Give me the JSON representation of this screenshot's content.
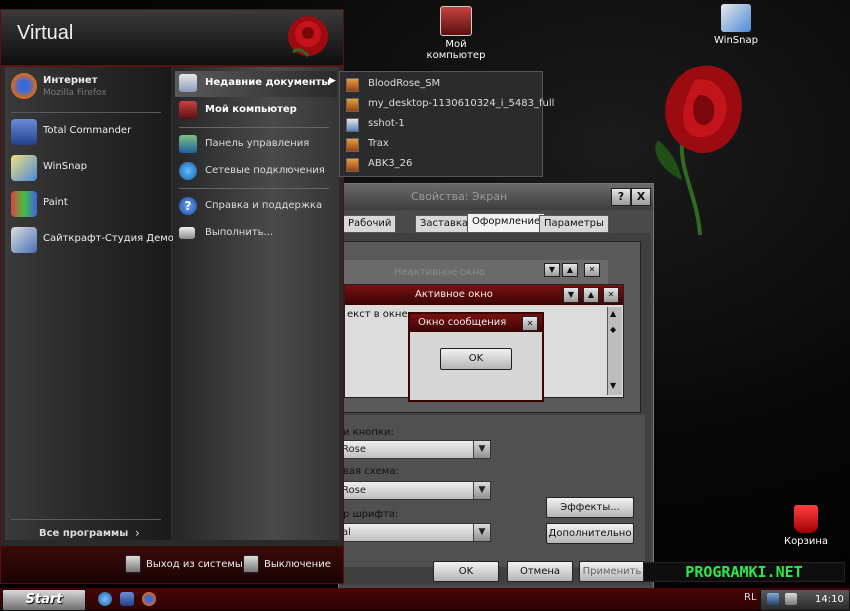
{
  "desktop": {
    "icons": [
      {
        "label_line1": "Мой",
        "label_line2": "компьютер"
      },
      {
        "label": "WinSnap"
      },
      {
        "label": "Корзина"
      }
    ]
  },
  "start_menu": {
    "user": "Virtual",
    "left_items": [
      {
        "label": "Интернет",
        "sublabel": "Mozilla Firefox"
      },
      {
        "label": "Total Commander"
      },
      {
        "label": "WinSnap"
      },
      {
        "label": "Paint"
      },
      {
        "label": "Сайткрафт-Студия Демо"
      }
    ],
    "all_programs": "Все программы",
    "right_items": [
      {
        "label": "Недавние документы"
      },
      {
        "label": "Мой компьютер"
      },
      {
        "label": "Панель управления"
      },
      {
        "label": "Сетевые подключения"
      },
      {
        "label": "Справка и поддержка"
      },
      {
        "label": "Выполнить..."
      }
    ],
    "logoff": "Выход из системы",
    "shutdown": "Выключение"
  },
  "recent_docs": [
    "BloodRose_SM",
    "my_desktop-1130610324_i_5483_full",
    "sshot-1",
    "Trax",
    "ABK3_26"
  ],
  "display_props": {
    "title": "Свойства: Экран",
    "help_btn": "?",
    "close_btn": "X",
    "tabs": [
      "Рабочий стол",
      "Заставка",
      "Оформление",
      "Параметры"
    ],
    "active_tab": "Оформление",
    "preview": {
      "inactive_title": "Неактивное окно",
      "active_title": "Активное окно",
      "window_text": "екст в окне",
      "msgbox_title": "Окно сообщения",
      "ok": "OK"
    },
    "labels": {
      "buttons": "и кнопки:",
      "color_scheme": "вая схема:",
      "font_size": "р шрифта:"
    },
    "values": {
      "buttons": "Rose",
      "color_scheme": "Rose",
      "font_size": "al"
    },
    "effects_btn": "Эффекты...",
    "advanced_btn": "Дополнительно",
    "ok_btn": "OK",
    "cancel_btn": "Отмена",
    "apply_btn": "Применить"
  },
  "taskbar": {
    "start": "Start",
    "lang": "RL",
    "clock": "14:10"
  },
  "watermark": "PROGRAMKI.NET",
  "colors": {
    "accent": "#6b0f0f",
    "rose": "#b50d12",
    "watermark": "#2ee84a"
  }
}
